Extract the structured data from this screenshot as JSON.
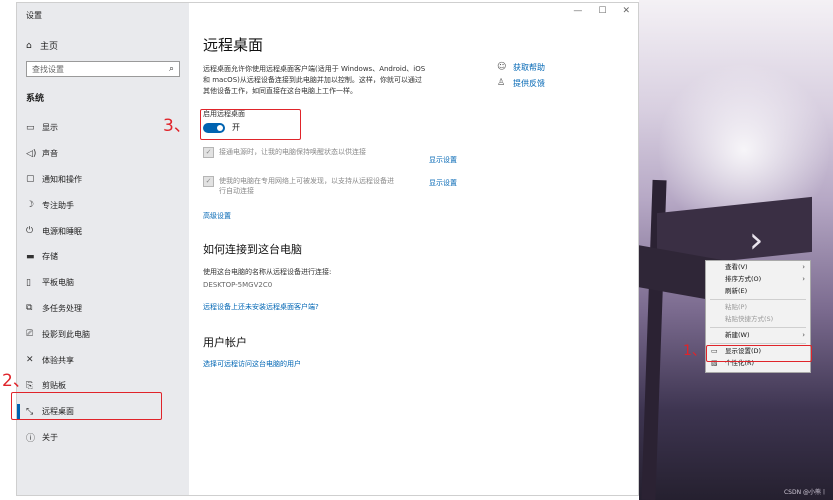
{
  "window": {
    "app_title": "设置",
    "controls": {
      "minimize": "—",
      "maximize": "☐",
      "close": "✕"
    }
  },
  "sidebar": {
    "home": "主页",
    "search_placeholder": "查找设置",
    "section": "系统",
    "items": [
      {
        "label": "显示",
        "icon": "monitor-icon"
      },
      {
        "label": "声音",
        "icon": "speaker-icon"
      },
      {
        "label": "通知和操作",
        "icon": "notification-icon"
      },
      {
        "label": "专注助手",
        "icon": "moon-icon"
      },
      {
        "label": "电源和睡眠",
        "icon": "power-icon"
      },
      {
        "label": "存储",
        "icon": "storage-icon"
      },
      {
        "label": "平板电脑",
        "icon": "tablet-icon"
      },
      {
        "label": "多任务处理",
        "icon": "multitask-icon"
      },
      {
        "label": "投影到此电脑",
        "icon": "projection-icon"
      },
      {
        "label": "体验共享",
        "icon": "share-icon"
      },
      {
        "label": "剪贴板",
        "icon": "clipboard-icon"
      },
      {
        "label": "远程桌面",
        "icon": "remote-desktop-icon"
      },
      {
        "label": "关于",
        "icon": "info-icon"
      }
    ]
  },
  "main": {
    "title": "远程桌面",
    "desc_line1": "远程桌面允许你使用远程桌面客户端(适用于 Windows、Android、iOS",
    "desc_line2": "和 macOS)从远程设备连接到此电脑并加以控制。这样，你就可以通过",
    "desc_line3": "其他设备工作，如同直接在这台电脑上工作一样。",
    "help_link": "获取帮助",
    "feedback_link": "提供反馈",
    "toggle_label": "启用远程桌面",
    "toggle_state": "开",
    "opt1_text": "接通电源时，让我的电脑保持唤醒状态以供连接",
    "opt1_link": "显示设置",
    "opt2_line1": "使我的电脑在专用网络上可被发现，以支持从远程设备进",
    "opt2_line2": "行自动连接",
    "opt2_link": "显示设置",
    "advanced": "高级设置",
    "how_title": "如何连接到这台电脑",
    "how_desc": "使用这台电脑的名称从远程设备进行连接:",
    "pc_name": "DESKTOP-5MGV2C0",
    "no_client": "远程设备上还未安装远程桌面客户端?",
    "accounts_title": "用户帐户",
    "accounts_link": "选择可远程访问这台电脑的用户"
  },
  "context_menu": {
    "view": "查看(V)",
    "sort": "排序方式(O)",
    "refresh": "刷新(E)",
    "paste": "粘贴(P)",
    "paste_shortcut": "粘贴快捷方式(S)",
    "new": "新建(W)",
    "display_settings": "显示设置(D)",
    "personalize": "个性化(R)"
  },
  "annotations": {
    "step1": "1、",
    "step2": "2、",
    "step3": "3、"
  },
  "watermark": "CSDN @小熊丨",
  "colors": {
    "accent": "#0063b1",
    "link": "#0066b4",
    "annotation": "#e0242a"
  }
}
